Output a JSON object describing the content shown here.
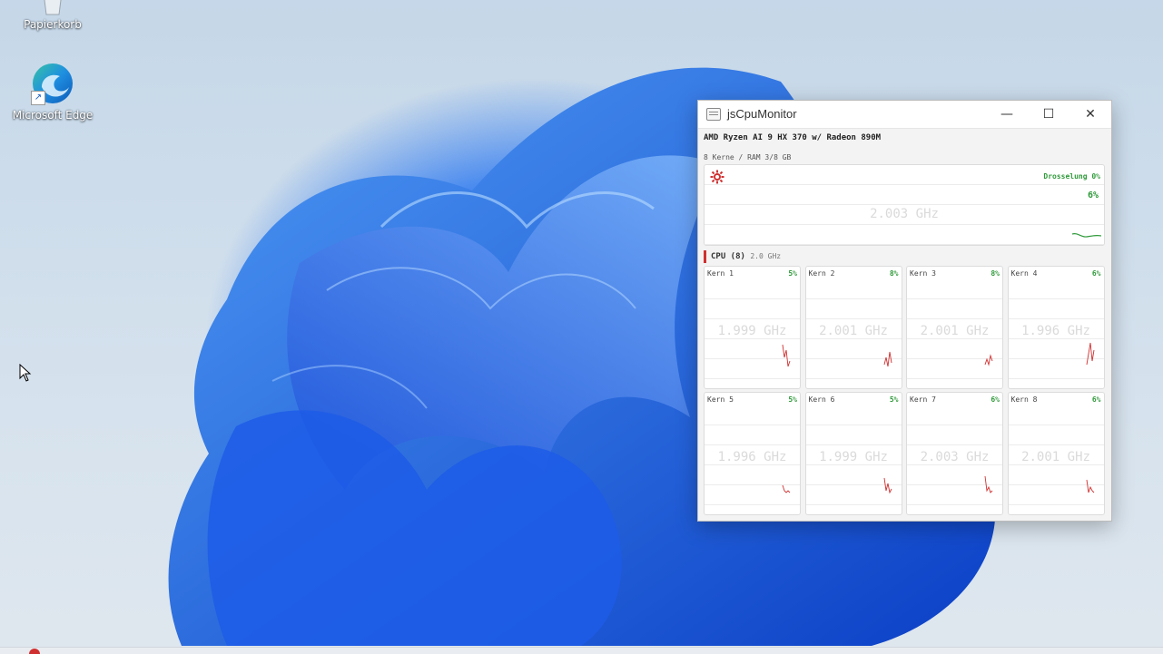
{
  "desktop": {
    "icons": [
      {
        "label": "Papierkorb"
      },
      {
        "label": "Microsoft Edge"
      }
    ]
  },
  "window": {
    "title": "jsCpuMonitor",
    "controls": {
      "minimize": "—",
      "maximize": "☐",
      "close": "✕"
    },
    "cpu_name": "AMD Ryzen AI 9 HX 370 w/ Radeon 890M",
    "cpu_info": "8 Kerne / RAM 3/8 GB",
    "overview": {
      "throttle": "Drosselung 0%",
      "total_percent": "6%",
      "total_freq": "2.003 GHz"
    },
    "section": {
      "label": "CPU (8)",
      "sub": "2.0 GHz"
    },
    "cores": [
      {
        "name": "Kern 1",
        "percent": "5%",
        "freq": "1.999 GHz"
      },
      {
        "name": "Kern 2",
        "percent": "8%",
        "freq": "2.001 GHz"
      },
      {
        "name": "Kern 3",
        "percent": "8%",
        "freq": "2.001 GHz"
      },
      {
        "name": "Kern 4",
        "percent": "6%",
        "freq": "1.996 GHz"
      },
      {
        "name": "Kern 5",
        "percent": "5%",
        "freq": "1.996 GHz"
      },
      {
        "name": "Kern 6",
        "percent": "5%",
        "freq": "1.999 GHz"
      },
      {
        "name": "Kern 7",
        "percent": "6%",
        "freq": "2.003 GHz"
      },
      {
        "name": "Kern 8",
        "percent": "6%",
        "freq": "2.001 GHz"
      }
    ]
  },
  "colors": {
    "accent_green": "#2f9a3a",
    "graph_red": "#d03030",
    "wallpaper_blue": "#1a56e6"
  },
  "icons": [
    "recycle-bin-icon",
    "edge-icon",
    "shortcut-arrow-icon",
    "app-icon",
    "gear-icon",
    "mouse-cursor-icon"
  ]
}
